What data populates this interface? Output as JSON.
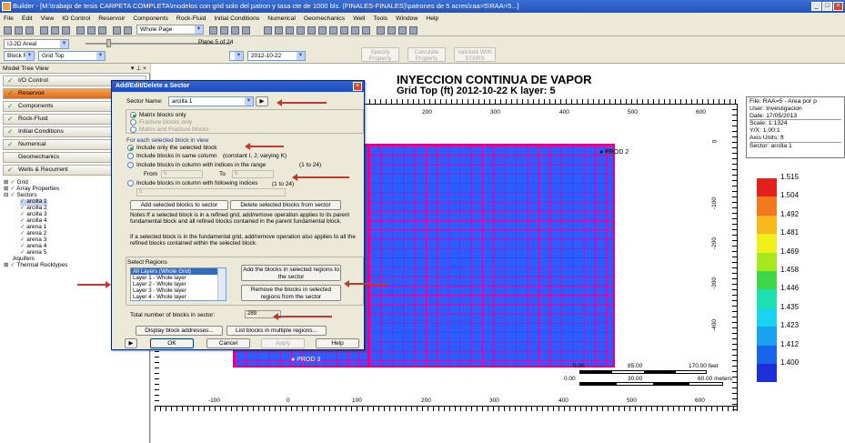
{
  "window": {
    "title": "Builder - [M:\\trabajo de tesis CARPETA COMPLETA\\modelos con grid solo del patron  y tasa cte de 1000 bls. (FINALES-FINALES)\\patrones de 5 acres\\raa=5\\RAA=5...]"
  },
  "menu": [
    "File",
    "Edit",
    "View",
    "IO Control",
    "Reservoir",
    "Components",
    "Rock-Fluid",
    "Initial Conditions",
    "Numerical",
    "Geomechanics",
    "Well",
    "Tools",
    "Window",
    "Help"
  ],
  "toolbar": {
    "view_select": "Whole Page",
    "areal_select": "IJ-2D Areal",
    "fill_select": "Block Fill",
    "grid_select": "Grid Top",
    "plane_label": "Plane 5 of 24",
    "date_select": "2012-10-22",
    "specify_property": "Specify Property",
    "calculate_property": "Calculate Property",
    "validate_stars": "Validate With STARS"
  },
  "model_tree": {
    "header": "Model Tree View",
    "nav": [
      "I/O Control",
      "Reservoir",
      "Components",
      "Rock-Fluid",
      "Initial Conditions",
      "Numerical",
      "Geomechanics",
      "Wells & Recurrent"
    ],
    "tree": [
      "Grid",
      "Array Properties",
      "Sectors",
      "arcilla 1",
      "arcilla 2",
      "arcilla 3",
      "arcilla 4",
      "arena 1",
      "arena 2",
      "arena 3",
      "arena 4",
      "arena 5",
      "Aquifers",
      "Thermal Rocktypes"
    ]
  },
  "dialog": {
    "title": "Add/Edit/Delete a Sector",
    "sector_name_label": "Sector Name:",
    "sector_name": "arcilla 1",
    "matrix_only": "Matrix blocks only",
    "fracture_only": "Fracture blocks only",
    "matrix_fracture": "Matrix and Fracture blocks",
    "for_each_label": "For each selected block in view",
    "include_only": "Include only the selected block",
    "include_column": "Include blocks in same column",
    "constant_ij": "(constant I, J; varying K)",
    "include_range": "Include blocks in column with indices in the range",
    "range_hint": "(1 to 24)",
    "from_label": "From",
    "from_value": "5",
    "to_label": "To",
    "to_value": "5",
    "include_following": "Include blocks in column with following indices",
    "following_hint": "(1 to 24)",
    "following_value": "5",
    "add_selected": "Add selected blocks to sector",
    "delete_selected": "Delete selected blocks from sector",
    "notes1": "Notes:If a selected block is in a refined grid, add/remove operation applies to its parent fundamental block and all refined blocks contained in the parent fundamental block.",
    "notes2": "If a selected block is in the fundamental grid, add/remove operation also applies to all the refined blocks contained within the selected block.",
    "select_regions_label": "Select Regions",
    "regions": [
      "All Layers (Whole Grid)",
      "Layer 1 - Whole layer",
      "Layer 2 - Whole layer",
      "Layer 3 - Whole layer",
      "Layer 4 - Whole layer"
    ],
    "add_regions": "Add the blocks in selected regions to the sector",
    "remove_regions": "Remove the blocks in selected regions from the sector",
    "total_label": "Total number of blocks in sector:",
    "total_value": "289",
    "display_addresses": "Display block addresses...",
    "list_blocks": "List blocks in multiple regions...",
    "ok": "OK",
    "cancel": "Cancel",
    "apply": "Apply",
    "help": "Help"
  },
  "plot": {
    "title": "INYECCION CONTINUA DE VAPOR",
    "subtitle": "Grid Top (ft) 2012-10-22     K layer: 5",
    "x_ticks_top": [
      "200",
      "300",
      "400",
      "500",
      "600"
    ],
    "x_ticks_bottom": [
      "-100",
      "0",
      "100",
      "200",
      "300",
      "400",
      "500",
      "600"
    ],
    "y_ticks": [
      "0",
      "-100",
      "-200",
      "-300",
      "-400"
    ],
    "wells": [
      "PROD 2",
      "PROD 3"
    ],
    "info": [
      "File: RAA=5 - Area por p",
      "User: Investigacion",
      "Date: 17/05/2013",
      "Scale: 1:1324",
      "Y/X: 1.00:1",
      "Axis Units: ft",
      "Sector: arcilla 1"
    ],
    "scale_feet": [
      "0.00",
      "85.00",
      "170.00 feet"
    ],
    "scale_meters": [
      "0.00",
      "30.00",
      "60.00 meters"
    ],
    "legend": [
      {
        "value": "1.515",
        "color": "#e3211c"
      },
      {
        "value": "1.504",
        "color": "#f2791e"
      },
      {
        "value": "1.492",
        "color": "#f7b81a"
      },
      {
        "value": "1.481",
        "color": "#eef21a"
      },
      {
        "value": "1.469",
        "color": "#a8e81e"
      },
      {
        "value": "1.458",
        "color": "#3fd64a"
      },
      {
        "value": "1.446",
        "color": "#1fe0b0"
      },
      {
        "value": "1.435",
        "color": "#1ad2f2"
      },
      {
        "value": "1.423",
        "color": "#1aa2f0"
      },
      {
        "value": "1.412",
        "color": "#1a63ea"
      },
      {
        "value": "1.400",
        "color": "#1a2fd8"
      }
    ]
  }
}
